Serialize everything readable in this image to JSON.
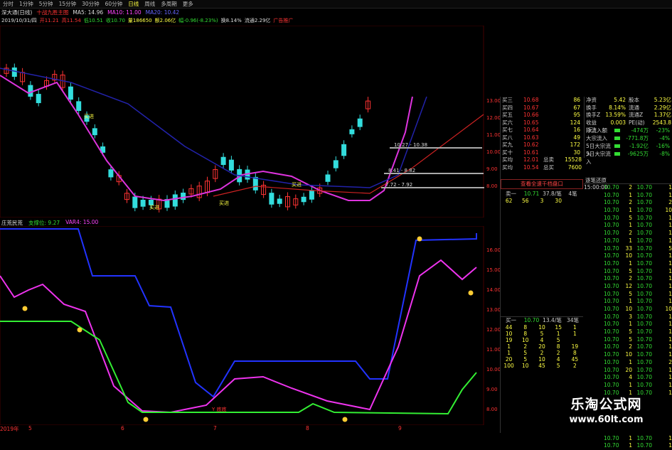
{
  "toolbar": {
    "items": [
      "分时",
      "1分钟",
      "5分钟",
      "15分钟",
      "30分钟",
      "60分钟",
      "日线",
      "周线",
      "多周期",
      "更多"
    ],
    "active_index": 6
  },
  "header": {
    "stock_name": "深大通(日线)",
    "indicator": "十战九胜主图",
    "ma5": "MA5: 14.96",
    "ma10": "MA10: 11.00",
    "ma20": "MA20: 10.42",
    "date": "2019/10/31/四",
    "open": "开11.21",
    "high": "高11.54",
    "low": "低10.51",
    "close": "收10.70",
    "vol": "量186650",
    "amount": "额2.06亿",
    "change": "幅-0.96(-8.23%)",
    "turnover": "换8.14%",
    "float": "流通2.29亿",
    "ad": "广告推广"
  },
  "main_chart": {
    "price_labels": [
      "13.00",
      "12.00",
      "11.00",
      "10.00",
      "9.00",
      "8.00"
    ],
    "annotations": [
      "10.27 - 10.38",
      "8.41 - 8.82",
      "7.72 - 7.92"
    ],
    "signals": [
      "买进",
      "买进",
      "买进",
      "买进"
    ],
    "colors": {
      "up": "#ff3333",
      "down": "#33dddd",
      "ma_purple": "#dd33dd",
      "ma_navy": "#2222aa",
      "ma_red": "#cc2222"
    }
  },
  "sub_chart": {
    "name": "庄荒民荒",
    "legend1": "支撑位: 9.27",
    "legend2": "VAR4: 15.00",
    "axis_labels": [
      "16.00",
      "15.00",
      "14.00",
      "13.00",
      "12.00",
      "11.00",
      "10.00",
      "9.00",
      "8.00"
    ],
    "signal": "Y 底底"
  },
  "bottom_axis": [
    "2019年",
    "5",
    "6",
    "7",
    "8",
    "9"
  ],
  "orderbook": {
    "rows": [
      {
        "label": "买三",
        "price": "10.68",
        "vol": "86"
      },
      {
        "label": "买四",
        "price": "10.67",
        "vol": "67"
      },
      {
        "label": "买五",
        "price": "10.66",
        "vol": "95"
      },
      {
        "label": "买六",
        "price": "10.65",
        "vol": "124"
      },
      {
        "label": "买七",
        "price": "10.64",
        "vol": "16"
      },
      {
        "label": "买八",
        "price": "10.63",
        "vol": "49"
      },
      {
        "label": "买九",
        "price": "10.62",
        "vol": "172"
      },
      {
        "label": "买十",
        "price": "10.61",
        "vol": "30"
      }
    ],
    "summary": [
      {
        "label": "买均",
        "price": "12.01",
        "k": "总卖",
        "v": "15528"
      },
      {
        "label": "买均",
        "price": "10.54",
        "k": "总买",
        "v": "7600"
      }
    ]
  },
  "stats": {
    "rows": [
      {
        "k": "净资",
        "v": "5.42",
        "k2": "股本",
        "v2": "5.23亿"
      },
      {
        "k": "换手",
        "v": "8.14%",
        "k2": "流通",
        "v2": "2.29亿"
      },
      {
        "k": "换手Z",
        "v": "13.59%",
        "k2": "流通Z",
        "v2": "1.37亿"
      },
      {
        "k": "收益(三)",
        "v": "0.003",
        "k2": "PE(动)",
        "v2": "2543.8"
      }
    ],
    "flows": [
      {
        "k": "净流入额",
        "v": "-474万",
        "p": "-23%"
      },
      {
        "k": "大宗流入",
        "v": "-771.8万",
        "p": "-4%"
      },
      {
        "k": "5日大宗流入",
        "v": "-1.92亿",
        "p": "-16%"
      },
      {
        "k": "5日大宗流入",
        "v": "-9625万",
        "p": "-8%"
      }
    ]
  },
  "notice": "查看全速千档盘口",
  "queue1": {
    "head": [
      "卖一",
      "10.71",
      "37.8/笔",
      "4笔"
    ],
    "values": [
      "62",
      "56",
      "3",
      "30",
      ""
    ]
  },
  "queue2": {
    "head": [
      "买一",
      "10.70",
      "13.4/笔",
      "34笔"
    ],
    "values": [
      "44",
      "8",
      "10",
      "15",
      "1",
      "10",
      "8",
      "5",
      "1",
      "1",
      "19",
      "10",
      "4",
      "5",
      "",
      "1",
      "2",
      "20",
      "8",
      "19",
      "1",
      "5",
      "2",
      "2",
      "8",
      "20",
      "5",
      "10",
      "4",
      "45",
      "100",
      "10",
      "45",
      "5",
      "2"
    ]
  },
  "ticks_panel": {
    "title": "逐笔还原",
    "rows": [
      {
        "t": "15:00:00",
        "p": "10.70",
        "q": "2",
        "t2": "10.70",
        "q2": "1"
      },
      {
        "t": "",
        "p": "10.70",
        "q": "1",
        "t2": "10.70",
        "q2": "1"
      },
      {
        "t": "",
        "p": "10.70",
        "q": "2",
        "t2": "10.70",
        "q2": "2"
      },
      {
        "t": "",
        "p": "10.70",
        "q": "1",
        "t2": "10.70",
        "q2": "10"
      },
      {
        "t": "",
        "p": "10.70",
        "q": "5",
        "t2": "10.70",
        "q2": "1"
      },
      {
        "t": "",
        "p": "10.70",
        "q": "1",
        "t2": "10.70",
        "q2": "1"
      },
      {
        "t": "",
        "p": "10.70",
        "q": "2",
        "t2": "10.70",
        "q2": "1"
      },
      {
        "t": "",
        "p": "10.70",
        "q": "1",
        "t2": "10.70",
        "q2": "1"
      },
      {
        "t": "",
        "p": "10.70",
        "q": "33",
        "t2": "10.70",
        "q2": "5"
      },
      {
        "t": "",
        "p": "10.70",
        "q": "10",
        "t2": "10.70",
        "q2": "1"
      },
      {
        "t": "",
        "p": "10.70",
        "q": "1",
        "t2": "10.70",
        "q2": "1"
      },
      {
        "t": "",
        "p": "10.70",
        "q": "5",
        "t2": "10.70",
        "q2": "1"
      },
      {
        "t": "",
        "p": "10.70",
        "q": "2",
        "t2": "10.70",
        "q2": "1"
      },
      {
        "t": "",
        "p": "10.70",
        "q": "12",
        "t2": "10.70",
        "q2": "1"
      },
      {
        "t": "",
        "p": "10.70",
        "q": "5",
        "t2": "10.70",
        "q2": "1"
      },
      {
        "t": "",
        "p": "10.70",
        "q": "1",
        "t2": "10.70",
        "q2": "1"
      },
      {
        "t": "",
        "p": "10.70",
        "q": "10",
        "t2": "10.70",
        "q2": "10"
      },
      {
        "t": "",
        "p": "10.70",
        "q": "3",
        "t2": "10.70",
        "q2": "1"
      },
      {
        "t": "",
        "p": "10.70",
        "q": "1",
        "t2": "10.70",
        "q2": "1"
      },
      {
        "t": "",
        "p": "10.70",
        "q": "5",
        "t2": "10.70",
        "q2": "1"
      },
      {
        "t": "",
        "p": "10.70",
        "q": "5",
        "t2": "10.70",
        "q2": "1"
      },
      {
        "t": "",
        "p": "10.70",
        "q": "2",
        "t2": "10.70",
        "q2": "1"
      },
      {
        "t": "",
        "p": "10.70",
        "q": "10",
        "t2": "10.70",
        "q2": "1"
      },
      {
        "t": "",
        "p": "10.70",
        "q": "1",
        "t2": "10.70",
        "q2": "2"
      },
      {
        "t": "",
        "p": "10.70",
        "q": "20",
        "t2": "10.70",
        "q2": "1"
      },
      {
        "t": "",
        "p": "10.70",
        "q": "4",
        "t2": "10.70",
        "q2": "1"
      },
      {
        "t": "",
        "p": "10.70",
        "q": "1",
        "t2": "10.70",
        "q2": "1"
      },
      {
        "t": "",
        "p": "10.70",
        "q": "1",
        "t2": "10.70",
        "q2": "1"
      },
      {
        "t": "",
        "p": "10.70",
        "q": "2",
        "t2": "10.70",
        "q2": "1"
      },
      {
        "t": "",
        "p": "10.70",
        "q": "5",
        "t2": "10.70",
        "q2": "1"
      },
      {
        "t": "",
        "p": "10.70",
        "q": "1",
        "t2": "10.70",
        "q2": "1"
      },
      {
        "t": "",
        "p": "10.70",
        "q": "4",
        "t2": "10.70",
        "q2": "1"
      },
      {
        "t": "",
        "p": "10.70",
        "q": "2",
        "t2": "10.70",
        "q2": "1"
      },
      {
        "t": "",
        "p": "10.70",
        "q": "1",
        "t2": "10.70",
        "q2": "1"
      },
      {
        "t": "",
        "p": "10.70",
        "q": "1",
        "t2": "10.70",
        "q2": "1"
      }
    ]
  },
  "watermark": {
    "title": "乐淘公式网",
    "url": "www.60lt.com"
  }
}
